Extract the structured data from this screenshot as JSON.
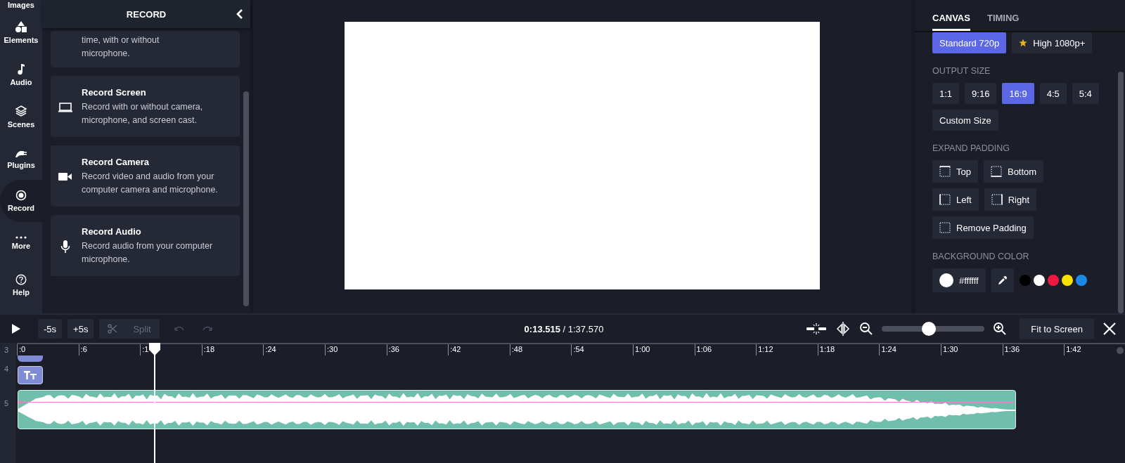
{
  "nav": [
    {
      "kind": "images",
      "label": "Images",
      "selected": false
    },
    {
      "kind": "elements",
      "label": "Elements",
      "selected": false
    },
    {
      "kind": "audio",
      "label": "Audio",
      "selected": false
    },
    {
      "kind": "scenes",
      "label": "Scenes",
      "selected": false
    },
    {
      "kind": "plugins",
      "label": "Plugins",
      "selected": false
    },
    {
      "kind": "record",
      "label": "Record",
      "selected": true
    },
    {
      "kind": "more",
      "label": "More",
      "selected": false
    },
    {
      "kind": "help",
      "label": "Help",
      "selected": false
    }
  ],
  "panel": {
    "title": "RECORD",
    "cards": [
      {
        "kind": "partial",
        "desc": "time, with or without microphone."
      },
      {
        "kind": "screen",
        "title": "Record Screen",
        "desc": "Record with or without camera, microphone, and screen cast."
      },
      {
        "kind": "camera",
        "title": "Record Camera",
        "desc": "Record video and audio from your computer camera and microphone."
      },
      {
        "kind": "audio",
        "title": "Record Audio",
        "desc": "Record audio from your computer microphone."
      }
    ]
  },
  "settings": {
    "tabs": [
      {
        "label": "CANVAS",
        "selected": true
      },
      {
        "label": "TIMING",
        "selected": false
      }
    ],
    "quality": [
      {
        "label": "Standard 720p",
        "selected": true,
        "premium": false
      },
      {
        "label": "High 1080p+",
        "selected": false,
        "premium": true
      }
    ],
    "output_size_label": "OUTPUT SIZE",
    "sizes": [
      {
        "label": "1:1",
        "selected": false
      },
      {
        "label": "9:16",
        "selected": false
      },
      {
        "label": "16:9",
        "selected": true
      },
      {
        "label": "4:5",
        "selected": false
      },
      {
        "label": "5:4",
        "selected": false
      },
      {
        "label": "Custom Size",
        "selected": false
      }
    ],
    "padding_label": "EXPAND PADDING",
    "padding": [
      {
        "kind": "top",
        "label": "Top"
      },
      {
        "kind": "bottom",
        "label": "Bottom"
      },
      {
        "kind": "left",
        "label": "Left"
      },
      {
        "kind": "right",
        "label": "Right"
      },
      {
        "kind": "none",
        "label": "Remove Padding"
      }
    ],
    "background_label": "BACKGROUND COLOR",
    "background_value": "#ffffff",
    "swatches": [
      {
        "color": "#000000"
      },
      {
        "color": "#ffffff"
      },
      {
        "color": "#ee1942"
      },
      {
        "color": "#ffe100"
      },
      {
        "color": "#1e88e5"
      }
    ]
  },
  "toolbar": {
    "back": "-5s",
    "forward": "+5s",
    "split": "Split",
    "current": "0:13.515",
    "total": "/ 1:37.570",
    "zoom": {
      "level": 0.45
    },
    "fit": "Fit to Screen"
  },
  "timeline": {
    "ticks": [
      ":0",
      ":6",
      ":1",
      ":18",
      ":24",
      ":30",
      ":36",
      ":42",
      ":48",
      ":54",
      "1:00",
      "1:06",
      "1:12",
      "1:18",
      "1:24",
      "1:30",
      "1:36",
      "1:42"
    ],
    "tracks": [
      "3",
      "4",
      "5"
    ]
  }
}
